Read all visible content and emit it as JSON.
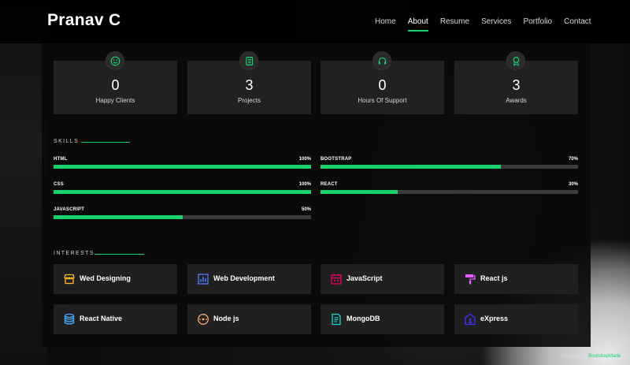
{
  "header": {
    "brand": "Pranav C",
    "nav": [
      "Home",
      "About",
      "Resume",
      "Services",
      "Portfolio",
      "Contact"
    ],
    "active": "About"
  },
  "stats": [
    {
      "number": "0",
      "label": "Happy Clients",
      "icon": "smile-icon"
    },
    {
      "number": "3",
      "label": "Projects",
      "icon": "journal-icon"
    },
    {
      "number": "0",
      "label": "Hours Of Support",
      "icon": "headset-icon"
    },
    {
      "number": "3",
      "label": "Awards",
      "icon": "award-icon"
    }
  ],
  "skills": {
    "title": "SKILLS",
    "left": [
      {
        "name": "HTML",
        "value": "100%",
        "percent": 100
      },
      {
        "name": "CSS",
        "value": "100%",
        "percent": 100
      },
      {
        "name": "JAVASCRIPT",
        "value": "50%",
        "percent": 50
      }
    ],
    "right": [
      {
        "name": "BOOTSTRAP",
        "value": "70%",
        "percent": 70
      },
      {
        "name": "REACT",
        "value": "30%",
        "percent": 30
      }
    ]
  },
  "interests": {
    "title": "INTERESTS",
    "items": [
      {
        "label": "Wed Designing",
        "icon": "store-icon",
        "color": "#ffbb2c"
      },
      {
        "label": "Web Development",
        "icon": "bar-chart-icon",
        "color": "#5578ff"
      },
      {
        "label": "JavaScript",
        "icon": "calendar-icon",
        "color": "#e80368"
      },
      {
        "label": "React js",
        "icon": "paint-roller-icon",
        "color": "#e361ff"
      },
      {
        "label": "React Native",
        "icon": "database-icon",
        "color": "#47aeff"
      },
      {
        "label": "Node js",
        "icon": "gradient-icon",
        "color": "#ffa76e"
      },
      {
        "label": "MongoDB",
        "icon": "file-list-icon",
        "color": "#11dbcf"
      },
      {
        "label": "eXpress",
        "icon": "base-station-icon",
        "color": "#4233ff"
      }
    ]
  },
  "credit": {
    "prefix": "Designed by",
    "link": "BootstrapMade"
  },
  "colors": {
    "accent": "#18d26e"
  }
}
